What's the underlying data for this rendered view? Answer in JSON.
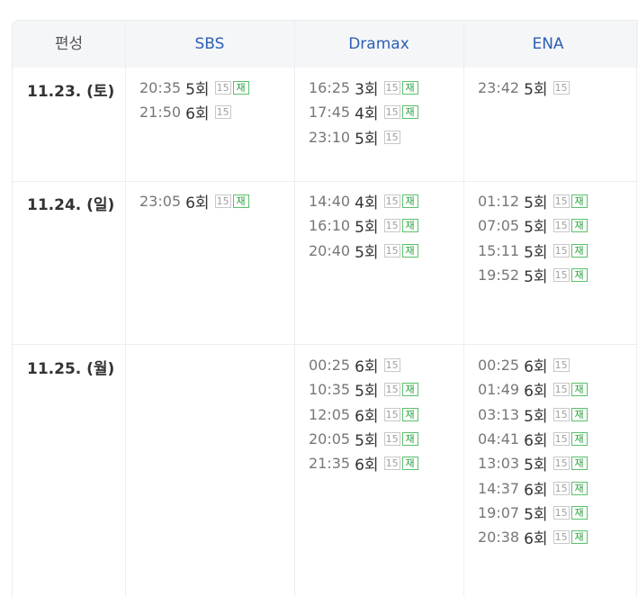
{
  "headers": {
    "first": "편성",
    "channels": [
      "SBS",
      "Dramax",
      "ENA"
    ]
  },
  "rows": [
    {
      "date": "11.23. (토)",
      "cells": [
        [
          {
            "time": "20:35",
            "ep": "5회",
            "age": "15",
            "re": "재"
          },
          {
            "time": "21:50",
            "ep": "6회",
            "age": "15",
            "re": ""
          }
        ],
        [
          {
            "time": "16:25",
            "ep": "3회",
            "age": "15",
            "re": "재"
          },
          {
            "time": "17:45",
            "ep": "4회",
            "age": "15",
            "re": "재"
          },
          {
            "time": "23:10",
            "ep": "5회",
            "age": "15",
            "re": ""
          }
        ],
        [
          {
            "time": "23:42",
            "ep": "5회",
            "age": "15",
            "re": ""
          }
        ]
      ]
    },
    {
      "date": "11.24. (일)",
      "cells": [
        [
          {
            "time": "23:05",
            "ep": "6회",
            "age": "15",
            "re": "재"
          }
        ],
        [
          {
            "time": "14:40",
            "ep": "4회",
            "age": "15",
            "re": "재"
          },
          {
            "time": "16:10",
            "ep": "5회",
            "age": "15",
            "re": "재"
          },
          {
            "time": "20:40",
            "ep": "5회",
            "age": "15",
            "re": "재"
          }
        ],
        [
          {
            "time": "01:12",
            "ep": "5회",
            "age": "15",
            "re": "재"
          },
          {
            "time": "07:05",
            "ep": "5회",
            "age": "15",
            "re": "재"
          },
          {
            "time": "15:11",
            "ep": "5회",
            "age": "15",
            "re": "재"
          },
          {
            "time": "19:52",
            "ep": "5회",
            "age": "15",
            "re": "재"
          }
        ]
      ]
    },
    {
      "date": "11.25. (월)",
      "cells": [
        [],
        [
          {
            "time": "00:25",
            "ep": "6회",
            "age": "15",
            "re": ""
          },
          {
            "time": "10:35",
            "ep": "5회",
            "age": "15",
            "re": "재"
          },
          {
            "time": "12:05",
            "ep": "6회",
            "age": "15",
            "re": "재"
          },
          {
            "time": "20:05",
            "ep": "5회",
            "age": "15",
            "re": "재"
          },
          {
            "time": "21:35",
            "ep": "6회",
            "age": "15",
            "re": "재"
          }
        ],
        [
          {
            "time": "00:25",
            "ep": "6회",
            "age": "15",
            "re": ""
          },
          {
            "time": "01:49",
            "ep": "6회",
            "age": "15",
            "re": "재"
          },
          {
            "time": "03:13",
            "ep": "5회",
            "age": "15",
            "re": "재"
          },
          {
            "time": "04:41",
            "ep": "6회",
            "age": "15",
            "re": "재"
          },
          {
            "time": "13:03",
            "ep": "5회",
            "age": "15",
            "re": "재"
          },
          {
            "time": "14:37",
            "ep": "6회",
            "age": "15",
            "re": "재"
          },
          {
            "time": "19:07",
            "ep": "5회",
            "age": "15",
            "re": "재"
          },
          {
            "time": "20:38",
            "ep": "6회",
            "age": "15",
            "re": "재"
          }
        ]
      ]
    }
  ],
  "colors": {
    "channel_header": "#2d5fb5",
    "rerun_badge": "#2aa13f",
    "header_bg": "#f5f6f8"
  }
}
